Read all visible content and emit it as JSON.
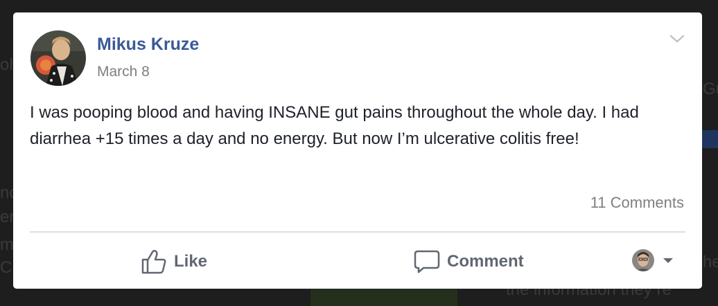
{
  "post": {
    "author": "Mikus Kruze",
    "date": "March 8",
    "text": "I was pooping blood and having INSANE gut pains throughout the whole day. I had diarrhea +15 times a day and no energy. But now I’m ulcerative colitis free!",
    "comments_count": "11 Comments"
  },
  "actions": {
    "like_label": "Like",
    "comment_label": "Comment"
  },
  "icons": {
    "menu": "chevron-down-icon",
    "like": "thumbs-up-icon",
    "comment": "speech-bubble-icon",
    "reaction_dropdown": "caret-down-icon"
  },
  "colors": {
    "author_link": "#3b5998",
    "muted_text": "#7f7f7f",
    "action_text": "#606770",
    "body_text": "#1d2129"
  }
}
